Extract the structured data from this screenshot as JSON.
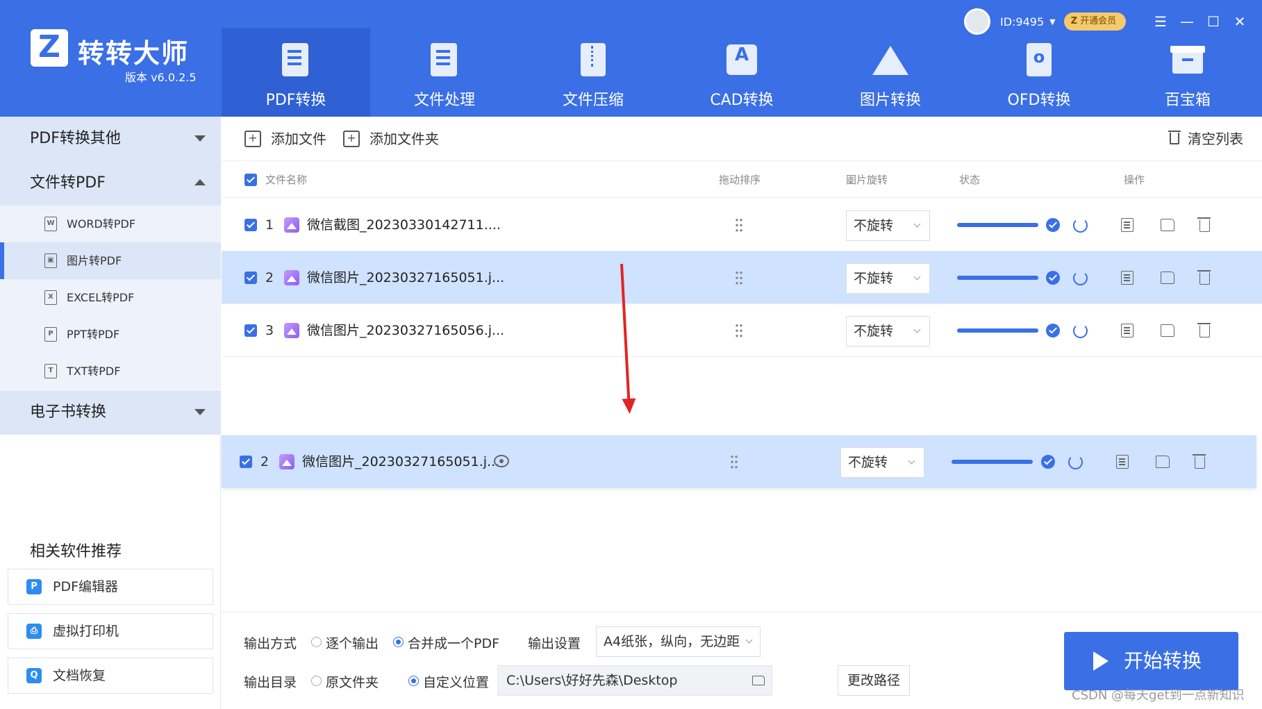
{
  "app": {
    "name": "转转大师",
    "version": "版本 v6.0.2.5"
  },
  "user": {
    "id": "ID:9495",
    "vip_label": "开通会员",
    "vip_mark": "Z"
  },
  "window_controls": [
    "☰",
    "—",
    "☐",
    "✕"
  ],
  "nav_tabs": [
    {
      "label": "PDF转换",
      "icon": "pdf-convert-icon",
      "active": true
    },
    {
      "label": "文件处理",
      "icon": "file-process-icon"
    },
    {
      "label": "文件压缩",
      "icon": "zip-icon"
    },
    {
      "label": "CAD转换",
      "icon": "cad-icon"
    },
    {
      "label": "图片转换",
      "icon": "image-icon"
    },
    {
      "label": "OFD转换",
      "icon": "ofd-icon"
    },
    {
      "label": "百宝箱",
      "icon": "toolbox-icon"
    }
  ],
  "sidebar": {
    "categories": [
      {
        "label": "PDF转换其他",
        "expanded": false
      },
      {
        "label": "文件转PDF",
        "expanded": true
      },
      {
        "label": "电子书转换",
        "expanded": false
      }
    ],
    "items": [
      {
        "label": "WORD转PDF",
        "glyph": "W"
      },
      {
        "label": "图片转PDF",
        "glyph": "▣",
        "active": true
      },
      {
        "label": "EXCEL转PDF",
        "glyph": "X"
      },
      {
        "label": "PPT转PDF",
        "glyph": "P"
      },
      {
        "label": "TXT转PDF",
        "glyph": "T"
      }
    ],
    "recommend_title": "相关软件推荐",
    "recommend": [
      {
        "label": "PDF编辑器",
        "glyph": "P"
      },
      {
        "label": "虚拟打印机",
        "glyph": "⎙"
      },
      {
        "label": "文档恢复",
        "glyph": "Q"
      }
    ]
  },
  "toolbar": {
    "add_file": "添加文件",
    "add_folder": "添加文件夹",
    "clear": "清空列表"
  },
  "table": {
    "headers": {
      "name": "文件名称",
      "sort": "拖动排序",
      "rotate": "图片旋转",
      "status": "状态",
      "action": "操作"
    },
    "rows": [
      {
        "index": "1",
        "name": "微信截图_20230330142711....",
        "rotate": "不旋转",
        "progress": 1.0
      },
      {
        "index": "2",
        "name": "微信图片_20230327165051.j...",
        "rotate": "不旋转",
        "progress": 1.0,
        "selected": true
      },
      {
        "index": "3",
        "name": "微信图片_20230327165056.j...",
        "rotate": "不旋转",
        "progress": 1.0
      }
    ],
    "dragging_row": {
      "index": "2",
      "name": "微信图片_20230327165051.j...",
      "rotate": "不旋转",
      "progress": 1.0
    }
  },
  "output": {
    "mode_label": "输出方式",
    "mode_options": [
      "逐个输出",
      "合并成一个PDF"
    ],
    "mode_selected": "合并成一个PDF",
    "settings_label": "输出设置",
    "settings_value": "A4纸张，纵向，无边距",
    "dir_label": "输出目录",
    "dir_options": [
      "原文件夹",
      "自定义位置"
    ],
    "dir_selected": "自定义位置",
    "path": "C:\\Users\\好好先森\\Desktop",
    "change_path": "更改路径",
    "start": "开始转换"
  },
  "watermark": "CSDN @每天get到一点新知识",
  "colors": {
    "primary": "#3a6fe6",
    "active_tab": "#2f60d4",
    "selected_row": "#cfe2ff",
    "arrow": "#e02525"
  }
}
